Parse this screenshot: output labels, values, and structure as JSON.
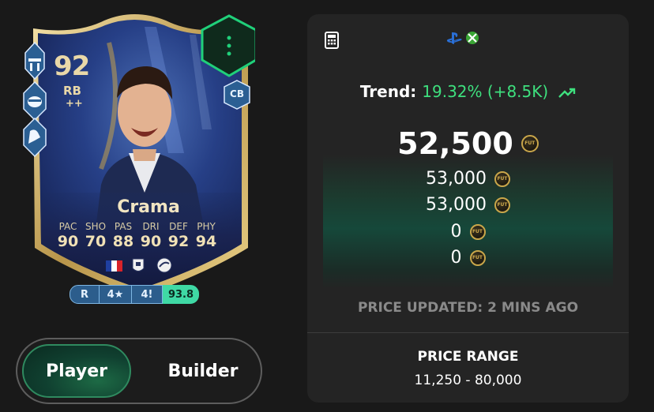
{
  "card": {
    "rating": "92",
    "position": "RB",
    "position_plus": "++",
    "alt_position": "CB",
    "name": "Crama",
    "stats": [
      {
        "label": "PAC",
        "value": "90"
      },
      {
        "label": "SHO",
        "value": "70"
      },
      {
        "label": "PAS",
        "value": "88"
      },
      {
        "label": "DRI",
        "value": "90"
      },
      {
        "label": "DEF",
        "value": "92"
      },
      {
        "label": "PHY",
        "value": "94"
      }
    ],
    "badges": {
      "foot": "R",
      "skill": "4★",
      "weak_foot": "4!",
      "score": "93.8"
    },
    "playstyle_icons": [
      "roadblock-icon",
      "raccoon-icon",
      "bruiser-arm-icon"
    ]
  },
  "toggle": {
    "player_label": "Player",
    "builder_label": "Builder"
  },
  "panel": {
    "trend_label": "Trend:",
    "trend_value": "19.32% (+8.5K)",
    "main_price": "52,500",
    "prices": [
      "53,000",
      "53,000",
      "0",
      "0"
    ],
    "coin_label": "FUT",
    "updated": "PRICE UPDATED: 2 MINS AGO",
    "range_label": "PRICE RANGE",
    "range_value": "11,250 - 80,000"
  },
  "colors": {
    "background": "#191919",
    "panel": "#242424",
    "trend_green": "#3ee07e",
    "coin_gold": "#c9a64a",
    "card_gold": "#e9d8a8",
    "alt_pos_green": "#20d07a",
    "score_badge": "#3fd9a5"
  }
}
